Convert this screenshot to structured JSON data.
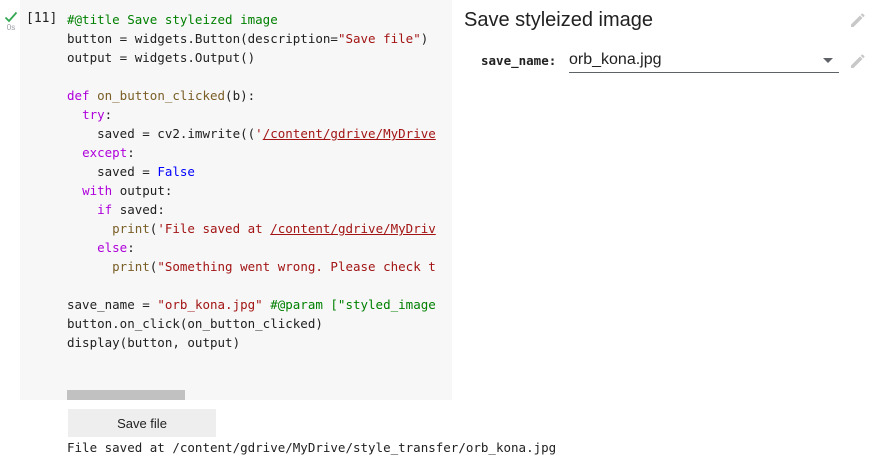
{
  "cell": {
    "elapsed": "0s",
    "exec_count": "[11]",
    "code_lines": [
      [
        {
          "t": "#@title Save styleized image",
          "c": "cm"
        }
      ],
      [
        {
          "t": "button = widgets.Button(description="
        },
        {
          "t": "\"Save file\"",
          "c": "st"
        },
        {
          "t": ")"
        }
      ],
      [
        {
          "t": "output = widgets.Output()"
        }
      ],
      [
        {
          "t": ""
        }
      ],
      [
        {
          "t": "def ",
          "c": "kw"
        },
        {
          "t": "on_button_clicked",
          "c": "fn"
        },
        {
          "t": "(b):"
        }
      ],
      [
        {
          "t": "  "
        },
        {
          "t": "try",
          "c": "kw"
        },
        {
          "t": ":"
        }
      ],
      [
        {
          "t": "    saved = cv2.imwrite(("
        },
        {
          "t": "'",
          "c": "st"
        },
        {
          "t": "/content/gdrive/MyDrive",
          "c": "st ul"
        }
      ],
      [
        {
          "t": "  "
        },
        {
          "t": "except",
          "c": "kw"
        },
        {
          "t": ":"
        }
      ],
      [
        {
          "t": "    saved = "
        },
        {
          "t": "False",
          "c": "cn"
        }
      ],
      [
        {
          "t": "  "
        },
        {
          "t": "with ",
          "c": "kw"
        },
        {
          "t": "output:"
        }
      ],
      [
        {
          "t": "    "
        },
        {
          "t": "if ",
          "c": "kw"
        },
        {
          "t": "saved:"
        }
      ],
      [
        {
          "t": "      "
        },
        {
          "t": "print",
          "c": "fn"
        },
        {
          "t": "("
        },
        {
          "t": "'File saved at ",
          "c": "st"
        },
        {
          "t": "/content/gdrive/MyDriv",
          "c": "st ul"
        }
      ],
      [
        {
          "t": "    "
        },
        {
          "t": "else",
          "c": "kw"
        },
        {
          "t": ":"
        }
      ],
      [
        {
          "t": "      "
        },
        {
          "t": "print",
          "c": "fn"
        },
        {
          "t": "("
        },
        {
          "t": "\"Something went wrong. Please check t",
          "c": "st"
        }
      ],
      [
        {
          "t": ""
        }
      ],
      [
        {
          "t": "save_name = "
        },
        {
          "t": "\"orb_kona.jpg\"",
          "c": "st"
        },
        {
          "t": " "
        },
        {
          "t": "#@param [\"styled_image",
          "c": "cm"
        }
      ],
      [
        {
          "t": "button.on_click(on_button_clicked)"
        }
      ],
      [
        {
          "t": "display(button, output)"
        }
      ]
    ]
  },
  "form": {
    "title": "Save styleized image",
    "param_label": "save_name:",
    "param_value": "orb_kona.jpg"
  },
  "widget": {
    "button_label": "Save file",
    "output_text": "File saved at /content/gdrive/MyDrive/style_transfer/orb_kona.jpg"
  },
  "icons": {
    "status": "check-icon",
    "edit": "pencil-icon"
  },
  "colors": {
    "check": "#34a853",
    "comment": "#008000",
    "keyword": "#af00db",
    "string": "#a31515"
  }
}
